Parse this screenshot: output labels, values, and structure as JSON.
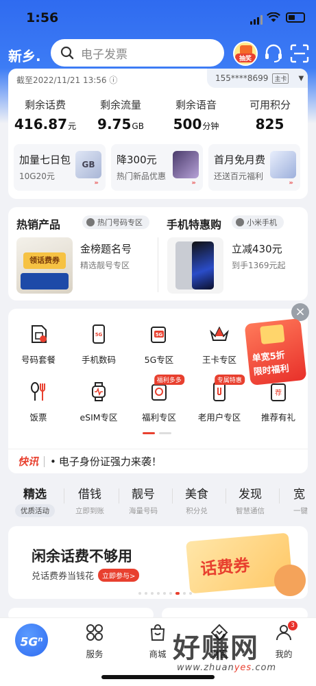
{
  "status_bar": {
    "time": "1:56"
  },
  "header": {
    "city": "新乡",
    "search_placeholder": "电子发票",
    "gift_label": "抽奖"
  },
  "account": {
    "as_of": "截至2022/11/21 13:56",
    "phone": "155****8699",
    "phone_tag": "主卡",
    "stats": [
      {
        "label": "剩余话费",
        "value": "416.87",
        "unit": "元"
      },
      {
        "label": "剩余流量",
        "value": "9.75",
        "unit": "GB"
      },
      {
        "label": "剩余语音",
        "value": "500",
        "unit": "分钟"
      },
      {
        "label": "可用积分",
        "value": "825",
        "unit": ""
      }
    ],
    "promos": [
      {
        "title": "加量七日包",
        "sub": "10G20元",
        "img_text": "GB"
      },
      {
        "title": "降300元",
        "sub": "热门新品优惠",
        "img_text": ""
      },
      {
        "title": "首月免月费",
        "sub": "还送百元福利",
        "img_text": ""
      }
    ]
  },
  "hot_section": {
    "left_title": "热销产品",
    "left_chip": "热门号码专区",
    "right_title": "手机特惠购",
    "right_chip": "小米手机",
    "left_product": {
      "thumb_text": "领话费券",
      "title": "金榜题名号",
      "sub": "精选靓号专区"
    },
    "right_product": {
      "title": "立减430元",
      "sub": "到手1369元起"
    }
  },
  "services": {
    "items": [
      {
        "label": "号码套餐",
        "icon": "sim-card-icon",
        "badge": ""
      },
      {
        "label": "手机数码",
        "icon": "phone-5g-icon",
        "badge": ""
      },
      {
        "label": "5G专区",
        "icon": "5g-zone-icon",
        "badge": ""
      },
      {
        "label": "王卡专区",
        "icon": "crown-card-icon",
        "badge": ""
      },
      {
        "label": "饭票",
        "icon": "fork-spoon-icon",
        "badge": ""
      },
      {
        "label": "eSIM专区",
        "icon": "smartwatch-icon",
        "badge": ""
      },
      {
        "label": "福利专区",
        "icon": "gift-box-icon",
        "badge": "福利多多"
      },
      {
        "label": "老用户专区",
        "icon": "old-user-phone-icon",
        "badge": "专属特惠"
      },
      {
        "label": "推荐有礼",
        "icon": "recommend-icon",
        "badge": ""
      }
    ],
    "red_packet": {
      "line1": "单宽5折",
      "line2": "限时福利"
    },
    "news_label": "快讯",
    "news_text": "电子身份证强力来袭！"
  },
  "tabs": [
    {
      "main": "精选",
      "sub": "优质活动",
      "active": true
    },
    {
      "main": "借钱",
      "sub": "立即到账",
      "active": false
    },
    {
      "main": "靓号",
      "sub": "海量号码",
      "active": false
    },
    {
      "main": "美食",
      "sub": "积分兑",
      "active": false
    },
    {
      "main": "发现",
      "sub": "智慧通信",
      "active": false
    },
    {
      "main": "宽",
      "sub": "一键",
      "active": false
    }
  ],
  "banner": {
    "title": "闲余话费不够用",
    "sub": "兑话费券当钱花",
    "button": "立即参与>",
    "coupon_text": "话费券"
  },
  "bottom_nav": {
    "home_label": "5G",
    "items": [
      {
        "label": "服务",
        "icon": "services-icon"
      },
      {
        "label": "商城",
        "icon": "shopping-bag-icon"
      },
      {
        "label": "财富",
        "icon": "wealth-icon"
      },
      {
        "label": "我的",
        "icon": "profile-icon",
        "badge": "3"
      }
    ]
  },
  "watermark": {
    "main": "好赚网",
    "url_a": "www.zhuan",
    "url_b": "yes",
    "url_c": ".com"
  }
}
